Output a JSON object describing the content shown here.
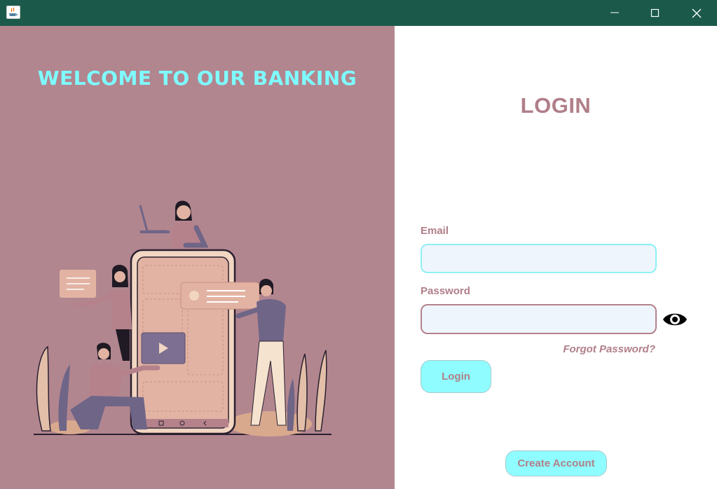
{
  "window": {
    "controls": {
      "minimize_icon": "minimize-icon",
      "maximize_icon": "maximize-icon",
      "close_icon": "close-icon"
    }
  },
  "left": {
    "welcome": "WELCOME TO OUR BANKING"
  },
  "login": {
    "title": "LOGIN",
    "email_label": "Email",
    "email_value": "",
    "password_label": "Password",
    "password_value": "",
    "forgot_label": "Forgot Password?",
    "login_button": "Login",
    "create_button": "Create Account"
  },
  "colors": {
    "titlebar": "#1b5a4b",
    "left_bg": "#b2868f",
    "accent_cyan": "#8ffdff",
    "text_mauve": "#b07f89"
  }
}
